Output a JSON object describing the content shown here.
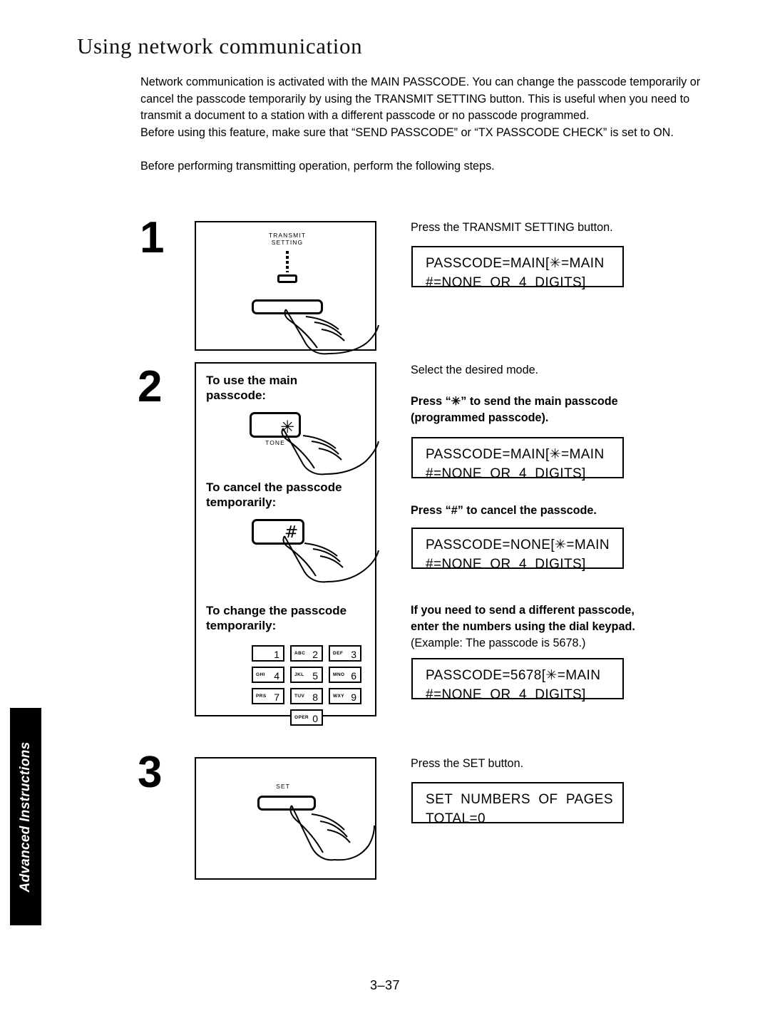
{
  "page": {
    "title": "Using network communication",
    "number": "3–37",
    "side_tab_label": "Advanced Instructions"
  },
  "intro": {
    "paragraph1": "Network communication is activated with the MAIN PASSCODE. You can change the passcode temporarily or cancel the passcode temporarily by using the TRANSMIT SETTING button. This is useful when you need to transmit a document to a station with a different passcode or no passcode programmed.",
    "paragraph2": "Before using this feature, make sure that “SEND PASSCODE” or “TX PASSCODE CHECK” is set to ON.",
    "paragraph3": "Before performing transmitting operation, perform the following steps."
  },
  "steps": [
    {
      "number": "1",
      "figure": {
        "button_label": "TRANSMIT\nSETTING"
      },
      "instruction": "Press the TRANSMIT SETTING button.",
      "lcd": {
        "line1": "PASSCODE=MAIN[✳=MAIN",
        "line2": "#=NONE  OR  4  DIGITS]"
      }
    },
    {
      "number": "2",
      "figure": {
        "caption1": "To use the main\npasscode:",
        "star_key_glyph": "✳",
        "star_key_sublabel": "TONE",
        "caption2": "To cancel the passcode\ntemporarily:",
        "hash_key_glyph": "#",
        "caption3": "To change the passcode\ntemporarily:",
        "keypad": [
          {
            "digit": "1",
            "letters": ""
          },
          {
            "digit": "2",
            "letters": "ABC"
          },
          {
            "digit": "3",
            "letters": "DEF"
          },
          {
            "digit": "4",
            "letters": "GHI"
          },
          {
            "digit": "5",
            "letters": "JKL"
          },
          {
            "digit": "6",
            "letters": "MNO"
          },
          {
            "digit": "7",
            "letters": "PRS"
          },
          {
            "digit": "8",
            "letters": "TUV"
          },
          {
            "digit": "9",
            "letters": "WXY"
          },
          {
            "digit": "0",
            "letters": "OPER"
          }
        ]
      },
      "instruction_intro": "Select the desired mode.",
      "blocks": [
        {
          "heading": "Press “✳” to send the main passcode\n(programmed passcode).",
          "lcd": {
            "line1": "PASSCODE=MAIN[✳=MAIN",
            "line2": "#=NONE  OR  4  DIGITS]"
          }
        },
        {
          "heading": "Press “#” to cancel the passcode.",
          "lcd": {
            "line1": "PASSCODE=NONE[✳=MAIN",
            "line2": "#=NONE  OR  4  DIGITS]"
          }
        },
        {
          "heading": "If you need to send a different passcode,\nenter the numbers using the dial keypad.",
          "subnote": "(Example:  The passcode is 5678.)",
          "lcd": {
            "line1": "PASSCODE=5678[✳=MAIN",
            "line2": "#=NONE  OR  4  DIGITS]"
          }
        }
      ]
    },
    {
      "number": "3",
      "figure": {
        "button_label": "SET"
      },
      "instruction": "Press the SET button.",
      "lcd": {
        "line1": "SET  NUMBERS  OF  PAGES",
        "line2": "TOTAL=0"
      }
    }
  ]
}
